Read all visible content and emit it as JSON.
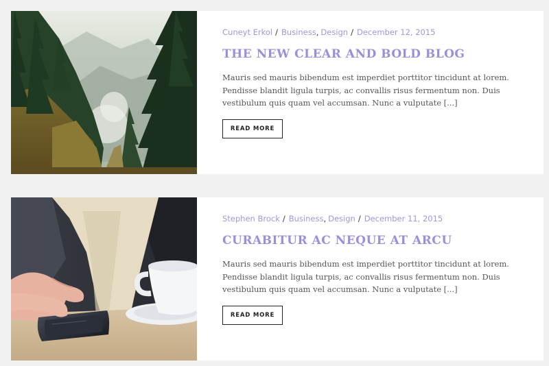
{
  "posts": [
    {
      "author": "Cuneyt Erkol",
      "categories": [
        "Business",
        "Design"
      ],
      "date": "December 12, 2015",
      "title": "THE NEW CLEAR AND BOLD BLOG",
      "excerpt": "Mauris sed mauris bibendum est imperdiet porttitor tincidunt at lorem. Pendisse blandit ligula turpis, ac convallis risus fermentum non. Duis vestibulum quis quam vel accumsan. Nunc a vulputate [...]",
      "button_label": "READ MORE"
    },
    {
      "author": "Stephen Brock",
      "categories": [
        "Business",
        "Design"
      ],
      "date": "December 11, 2015",
      "title": "CURABITUR AC NEQUE AT ARCU",
      "excerpt": "Mauris sed mauris bibendum est imperdiet porttitor tincidunt at lorem. Pendisse blandit ligula turpis, ac convallis risus fermentum non. Duis vestibulum quis quam vel accumsan. Nunc a vulputate [...]",
      "button_label": "READ MORE"
    }
  ],
  "separators": {
    "slash": "/",
    "comma": ","
  },
  "colors": {
    "accent": "#9990dc",
    "page_bg": "#f1f1f1",
    "card_bg": "#ffffff",
    "body_text": "#555555"
  }
}
